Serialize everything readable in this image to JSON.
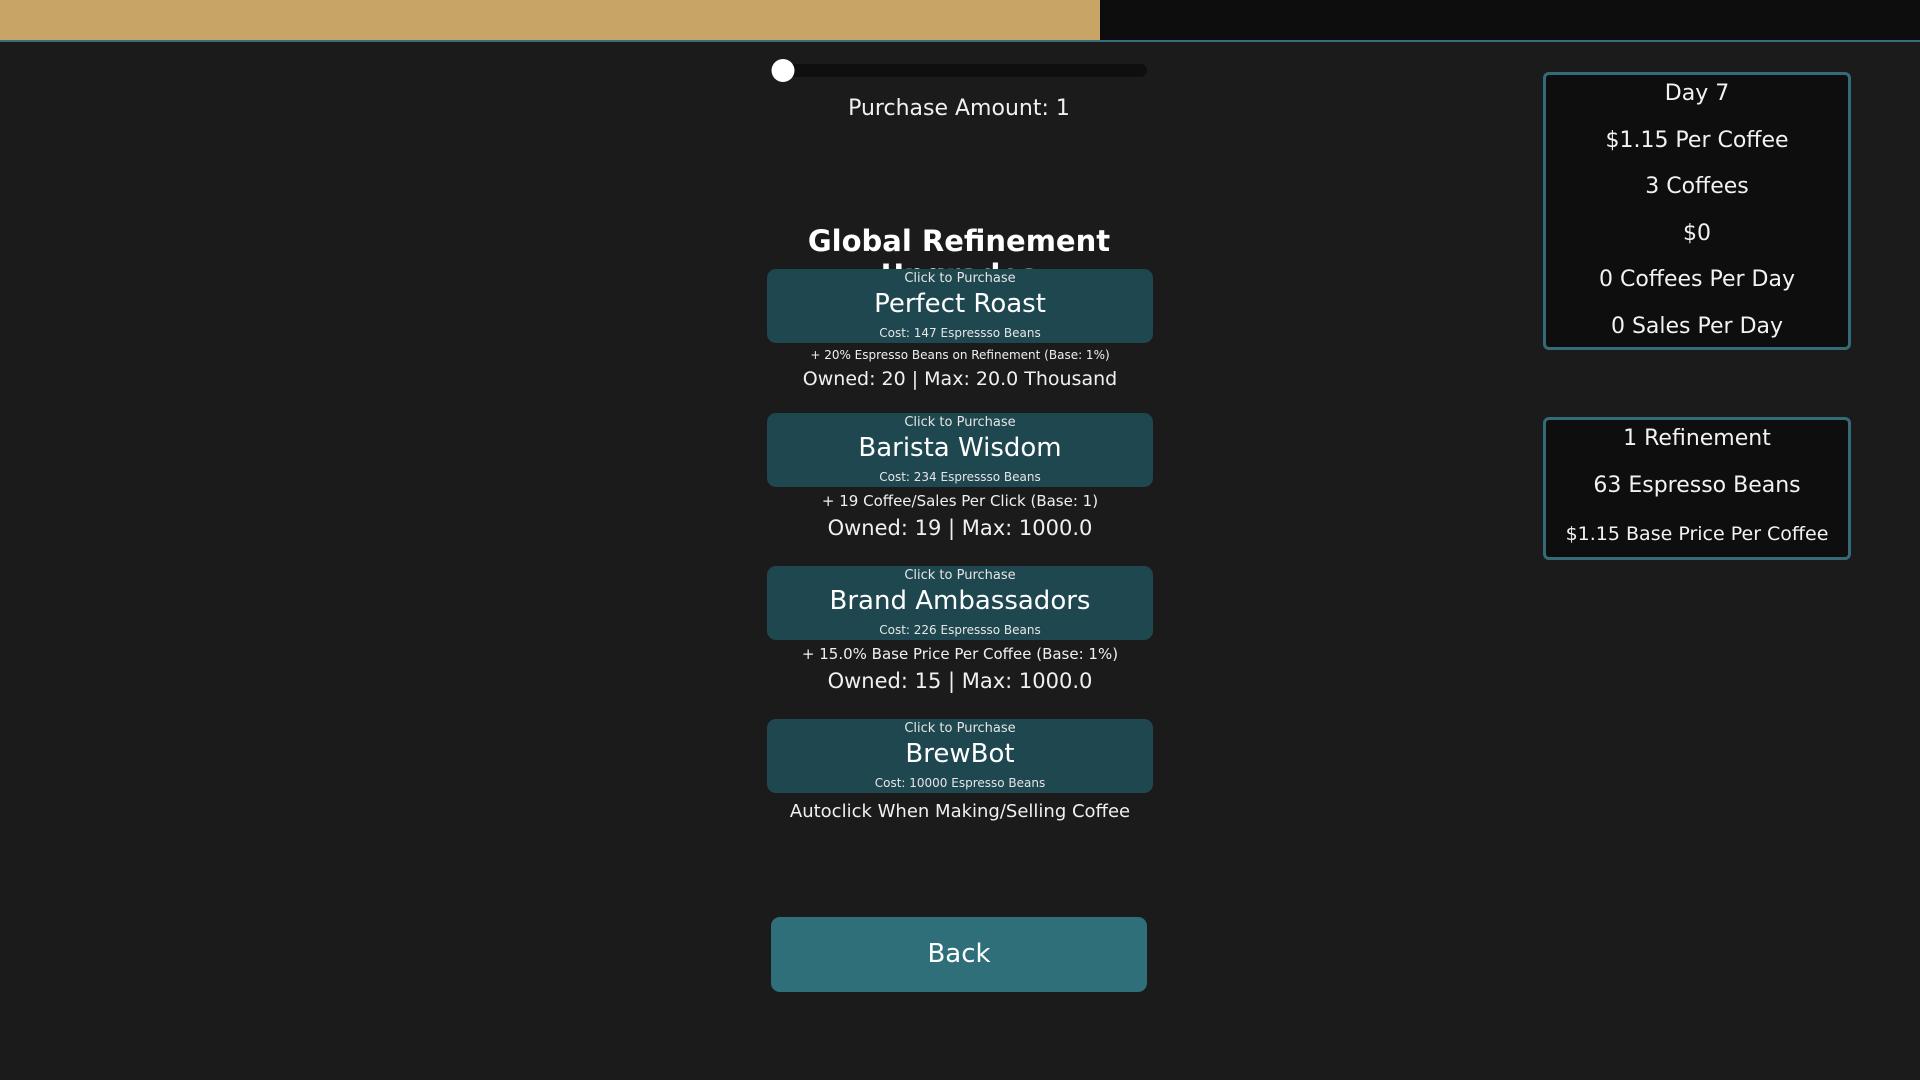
{
  "top_progress": {
    "fraction": 0.573
  },
  "slider": {
    "value": 1,
    "min": 1,
    "max": 100
  },
  "purchase_amount_label": "Purchase Amount: 1",
  "section_title": "Global Refinement Upgrades",
  "upgrades": [
    {
      "hint": "Click to Purchase",
      "name": "Perfect Roast",
      "cost": "Cost: 147 Espressso Beans",
      "description": "+ 20% Espresso Beans on Refinement (Base: 1%)",
      "owned": "Owned: 20 | Max: 20.0 Thousand"
    },
    {
      "hint": "Click to Purchase",
      "name": "Barista Wisdom",
      "cost": "Cost: 234 Espressso Beans",
      "description": "+ 19 Coffee/Sales Per Click (Base: 1)",
      "owned": "Owned: 19 | Max: 1000.0"
    },
    {
      "hint": "Click to Purchase",
      "name": "Brand Ambassadors",
      "cost": "Cost: 226 Espressso Beans",
      "description": "+ 15.0% Base Price Per Coffee (Base: 1%)",
      "owned": "Owned: 15 | Max: 1000.0"
    },
    {
      "hint": "Click to Purchase",
      "name": "BrewBot",
      "cost": "Cost: 10000 Espresso Beans",
      "description": "Autoclick When Making/Selling Coffee"
    }
  ],
  "back_label": "Back",
  "stats_panel": {
    "lines": [
      "Day 7",
      "$1.15 Per Coffee",
      "3 Coffees",
      "$0",
      "0 Coffees Per Day",
      "0 Sales Per Day"
    ]
  },
  "refinement_panel": {
    "lines": [
      "1 Refinement",
      "63 Espresso Beans",
      "$1.15 Base Price Per Coffee"
    ]
  },
  "colors": {
    "background": "#1c1b1b",
    "progress_fill": "#c8a466",
    "button": "#1f4750",
    "back_button": "#2f6f7a",
    "panel_border": "#346b77"
  }
}
